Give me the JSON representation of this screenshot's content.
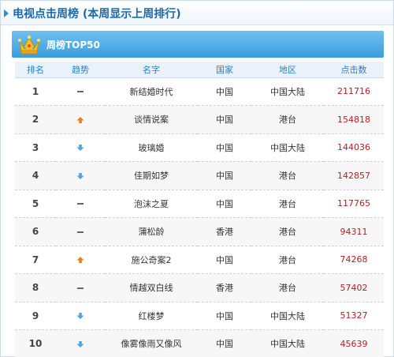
{
  "header": {
    "title": "电视点击周榜 (本周显示上周排行)"
  },
  "banner": {
    "label": "周榜TOP50"
  },
  "colors": {
    "up": "#f07c1f",
    "down": "#4da6de",
    "flat": "#666666",
    "clicks": "#b22222",
    "accent": "#2b7fc3"
  },
  "table": {
    "columns": [
      "排名",
      "趋势",
      "名字",
      "国家",
      "地区",
      "点击数"
    ],
    "rows": [
      {
        "rank": "1",
        "trend": "flat",
        "name": "新结婚时代",
        "country": "中国",
        "region": "中国大陆",
        "clicks": "211716"
      },
      {
        "rank": "2",
        "trend": "up",
        "name": "谈情说案",
        "country": "中国",
        "region": "港台",
        "clicks": "154818"
      },
      {
        "rank": "3",
        "trend": "down",
        "name": "玻璃婚",
        "country": "中国",
        "region": "中国大陆",
        "clicks": "144036"
      },
      {
        "rank": "4",
        "trend": "down",
        "name": "佳期如梦",
        "country": "中国",
        "region": "港台",
        "clicks": "142857"
      },
      {
        "rank": "5",
        "trend": "flat",
        "name": "泡沫之夏",
        "country": "中国",
        "region": "港台",
        "clicks": "117765"
      },
      {
        "rank": "6",
        "trend": "flat",
        "name": "蒲松龄",
        "country": "香港",
        "region": "港台",
        "clicks": "94311"
      },
      {
        "rank": "7",
        "trend": "up",
        "name": "施公奇案2",
        "country": "中国",
        "region": "港台",
        "clicks": "74268"
      },
      {
        "rank": "8",
        "trend": "flat",
        "name": "情越双白线",
        "country": "香港",
        "region": "港台",
        "clicks": "57402"
      },
      {
        "rank": "9",
        "trend": "down",
        "name": "红楼梦",
        "country": "中国",
        "region": "中国大陆",
        "clicks": "51327"
      },
      {
        "rank": "10",
        "trend": "down",
        "name": "像雾像雨又像风",
        "country": "中国",
        "region": "中国大陆",
        "clicks": "45639"
      }
    ]
  }
}
